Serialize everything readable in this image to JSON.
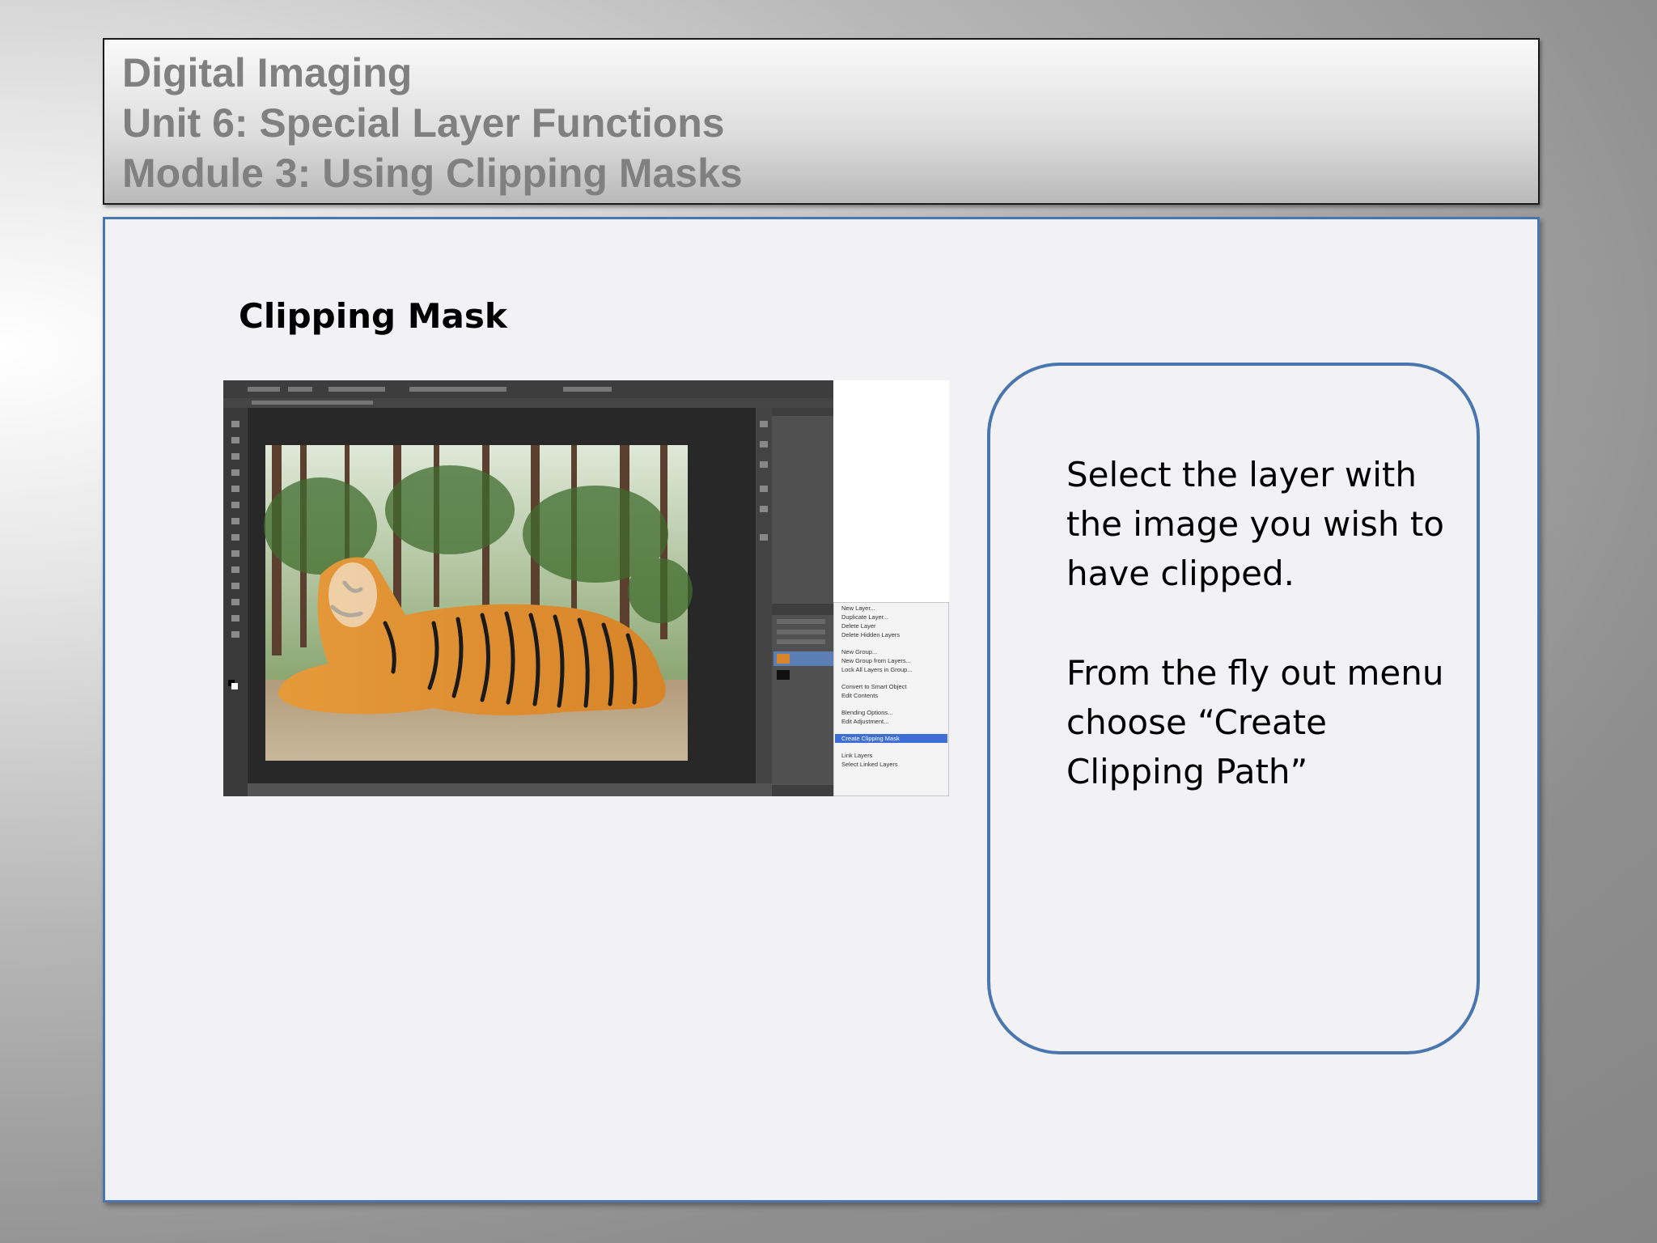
{
  "header": {
    "line1": "Digital Imaging",
    "line2": "Unit 6: Special Layer Functions",
    "line3": "Module 3: Using Clipping Masks"
  },
  "slide": {
    "section_title": "Clipping Mask",
    "callout": {
      "paragraph1": "Select the layer with the  image you wish to have clipped.",
      "paragraph2": "From the fly out menu choose “Create Clipping Path”"
    },
    "screenshot": {
      "flyout_menu_items": [
        "New Layer...",
        "Duplicate Layer...",
        "Delete Layer",
        "Delete Hidden Layers",
        "New Group...",
        "New Group from Layers...",
        "Lock All Layers in Group...",
        "Convert to Smart Object",
        "Edit Contents",
        "Blending Options...",
        "Edit Adjustment...",
        "Create Clipping Mask",
        "Link Layers",
        "Select Linked Layers"
      ],
      "highlighted_item": "Create Clipping Mask",
      "highlight_color": "#3d6fd6"
    }
  },
  "colors": {
    "header_text": "#808080",
    "border_accent": "#4a76b0",
    "panel_bg": "#f2f2f4"
  }
}
